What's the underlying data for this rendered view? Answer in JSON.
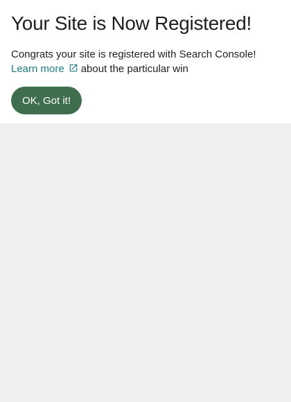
{
  "dialog": {
    "title": "Your Site is Now Registered!",
    "message_line1": "Congrats your site is registered with Search Console!",
    "learn_more_label": "Learn more",
    "message_line2_suffix": "about the particular win",
    "ok_button_label": "OK, Got it!",
    "external_link_icon": "external-link-icon"
  },
  "colors": {
    "link": "#1a7a80",
    "button_bg": "#3e6e4e",
    "button_text": "#ffffff",
    "card_bg": "#ffffff",
    "page_bg": "#efefef"
  }
}
